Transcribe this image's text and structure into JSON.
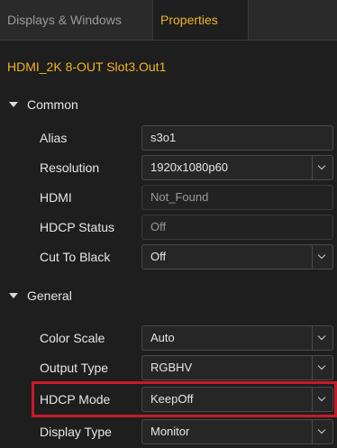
{
  "tabs": [
    {
      "label": "Displays & Windows",
      "active": false
    },
    {
      "label": "Properties",
      "active": true
    }
  ],
  "device_title": "HDMI_2K 8-OUT  Slot3.Out1",
  "sections": {
    "common": {
      "label": "Common",
      "rows": {
        "alias": {
          "label": "Alias",
          "value": "s3o1"
        },
        "resolution": {
          "label": "Resolution",
          "value": "1920x1080p60"
        },
        "hdmi": {
          "label": "HDMI",
          "value": "Not_Found"
        },
        "hdcp_status": {
          "label": "HDCP Status",
          "value": "Off"
        },
        "cut_to_black": {
          "label": "Cut To Black",
          "value": "Off"
        }
      }
    },
    "general": {
      "label": "General",
      "rows": {
        "color_scale": {
          "label": "Color Scale",
          "value": "Auto"
        },
        "output_type": {
          "label": "Output Type",
          "value": "RGBHV"
        },
        "hdcp_mode": {
          "label": "HDCP Mode",
          "value": "KeepOff"
        },
        "display_type": {
          "label": "Display Type",
          "value": "Monitor"
        }
      }
    }
  },
  "colors": {
    "accent": "#f0b429",
    "highlight": "#c8192b",
    "background": "#1e1e1e"
  },
  "icons": {
    "section_caret": "caret-down-icon",
    "dropdown": "chevron-down-icon"
  }
}
